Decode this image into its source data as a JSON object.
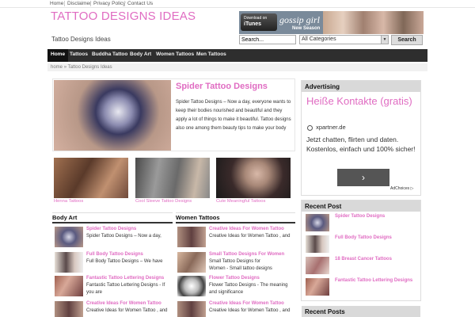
{
  "top_nav": [
    "Home",
    "Disclaimer",
    "Privacy Policy",
    "Contact Us"
  ],
  "site": {
    "title": "TATTOO DESIGNS IDEAS",
    "tagline": "Tattoo Designs Ideas"
  },
  "banner": {
    "itunes_line1": "Download on",
    "itunes_line2": "iTunes",
    "brand": "gossip girl",
    "subtitle": "New Season"
  },
  "search": {
    "value": "Search...",
    "category": "All Categories",
    "button": "Search"
  },
  "main_nav": [
    "Home",
    "Tattoos",
    "Buddha Tattoo",
    "Body Art",
    "Women Tattoos",
    "Men Tattoos"
  ],
  "breadcrumb": {
    "home": "home",
    "separator": "»",
    "current": "Tattoo Designs Ideas"
  },
  "featured": {
    "title": "Spider Tattoo Designs",
    "text": "Spider Tattoo Designs – Now a day, everyone wants to keep their bodies nourished and beautiful and they apply a lot of things to make it beautiful. Tattoo designs also one among them beauty tips to make your body"
  },
  "thumbs": [
    "Henna Tattoos",
    "Cool Sleeve Tattoo Designs",
    "Cute Meaningful Tattoos"
  ],
  "body_art": {
    "heading": "Body Art",
    "posts": [
      {
        "title": "Spider Tattoo Designs",
        "excerpt": [
          "Spider Tattoo Designs – Now a day,"
        ]
      },
      {
        "title": "Full Body Tattoo Designs",
        "excerpt": [
          "Full Body Tattoo Designs – We have"
        ]
      },
      {
        "title": "Fantastic Tattoo Lettering Designs",
        "excerpt": [
          "Fantastic Tattoo Lettering Designs - If",
          "you are"
        ]
      },
      {
        "title": "Creative Ideas For Women Tattoo",
        "excerpt": [
          "Creative Ideas for Women Tattoo , and"
        ]
      }
    ]
  },
  "women_tattoos": {
    "heading": "Women Tattoos",
    "posts": [
      {
        "title": "Creative Ideas For Women Tattoo",
        "excerpt": [
          "Creative Ideas for Women Tattoo , and"
        ]
      },
      {
        "title": "Small Tattoo Designs For Women",
        "excerpt": [
          "Small Tattoo Designs for",
          "Women - Small tattoo designs"
        ]
      },
      {
        "title": "Flower Tattoo Designs",
        "excerpt": [
          "Flower Tattoo Designs - The meaning",
          "and significance"
        ]
      },
      {
        "title": "Creative Ideas For Women Tattoo",
        "excerpt": [
          "Creative Ideas for Women Tattoo , and"
        ]
      }
    ]
  },
  "advertising": {
    "heading": "Advertising",
    "title": "Heiße Kontakte (gratis)",
    "source": "xpartner.de",
    "body": "Jetzt chatten, flirten und daten. Kostenlos, einfach und 100% sicher!",
    "button": "›",
    "adchoices": "AdChoices ▷"
  },
  "recent_post": {
    "heading": "Recent Post",
    "items": [
      "Spider Tattoo Designs",
      "Full Body Tattoo Designs",
      "18 Breast Cancer Tattoos",
      "Fantastic Tattoo Lettering Designs"
    ]
  },
  "recent_posts_heading": "Recent Posts",
  "colors": {
    "accent": "#e06cc2",
    "nav_bg": "#2e2e2e"
  }
}
